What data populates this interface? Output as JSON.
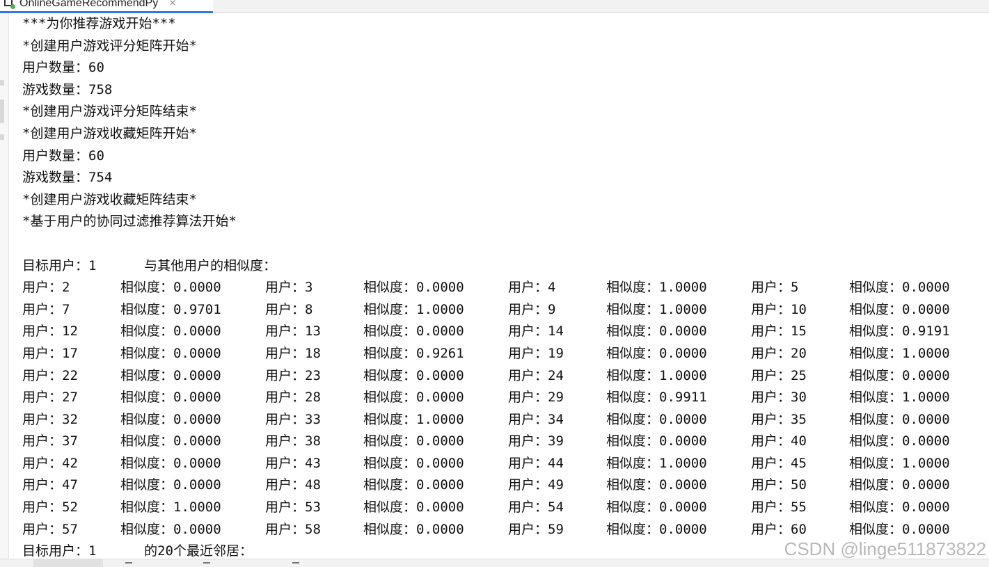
{
  "tab": {
    "title": "OnlineGameRecommendPy",
    "close_glyph": "×",
    "icon": "python-file-icon"
  },
  "console": {
    "lines": [
      "***为你推荐游戏开始***",
      "*创建用户游戏评分矩阵开始*",
      "用户数量：60",
      "游戏数量：758",
      "*创建用户游戏评分矩阵结束*",
      "*创建用户游戏收藏矩阵开始*",
      "用户数量：60",
      "游戏数量：754",
      "*创建用户游戏收藏矩阵结束*",
      "*基于用户的协同过滤推荐算法开始*",
      ""
    ],
    "target_header": "目标用户：1      与其他用户的相似度：",
    "user_prefix": "用户：",
    "sim_prefix": "相似度：",
    "similarity_rows": [
      [
        [
          "2",
          "0.0000"
        ],
        [
          "3",
          "0.0000"
        ],
        [
          "4",
          "1.0000"
        ],
        [
          "5",
          "0.0000"
        ]
      ],
      [
        [
          "7",
          "0.9701"
        ],
        [
          "8",
          "1.0000"
        ],
        [
          "9",
          "1.0000"
        ],
        [
          "10",
          "0.0000"
        ]
      ],
      [
        [
          "12",
          "0.0000"
        ],
        [
          "13",
          "0.0000"
        ],
        [
          "14",
          "0.0000"
        ],
        [
          "15",
          "0.9191"
        ]
      ],
      [
        [
          "17",
          "0.0000"
        ],
        [
          "18",
          "0.9261"
        ],
        [
          "19",
          "0.0000"
        ],
        [
          "20",
          "1.0000"
        ]
      ],
      [
        [
          "22",
          "0.0000"
        ],
        [
          "23",
          "0.0000"
        ],
        [
          "24",
          "1.0000"
        ],
        [
          "25",
          "0.0000"
        ]
      ],
      [
        [
          "27",
          "0.0000"
        ],
        [
          "28",
          "0.0000"
        ],
        [
          "29",
          "0.9911"
        ],
        [
          "30",
          "1.0000"
        ]
      ],
      [
        [
          "32",
          "0.0000"
        ],
        [
          "33",
          "1.0000"
        ],
        [
          "34",
          "0.0000"
        ],
        [
          "35",
          "0.0000"
        ]
      ],
      [
        [
          "37",
          "0.0000"
        ],
        [
          "38",
          "0.0000"
        ],
        [
          "39",
          "0.0000"
        ],
        [
          "40",
          "0.0000"
        ]
      ],
      [
        [
          "42",
          "0.0000"
        ],
        [
          "43",
          "0.0000"
        ],
        [
          "44",
          "1.0000"
        ],
        [
          "45",
          "1.0000"
        ]
      ],
      [
        [
          "47",
          "0.0000"
        ],
        [
          "48",
          "0.0000"
        ],
        [
          "49",
          "0.0000"
        ],
        [
          "50",
          "0.0000"
        ]
      ],
      [
        [
          "52",
          "1.0000"
        ],
        [
          "53",
          "0.0000"
        ],
        [
          "54",
          "0.0000"
        ],
        [
          "55",
          "0.0000"
        ]
      ],
      [
        [
          "57",
          "0.0000"
        ],
        [
          "58",
          "0.0000"
        ],
        [
          "59",
          "0.0000"
        ],
        [
          "60",
          "0.0000"
        ]
      ]
    ],
    "neighbors_header": "目标用户：1      的20个最近邻居："
  },
  "watermark": "CSDN @linge511873822",
  "colors": {
    "accent": "#3574f0",
    "text": "#111111",
    "background": "#ffffff"
  }
}
